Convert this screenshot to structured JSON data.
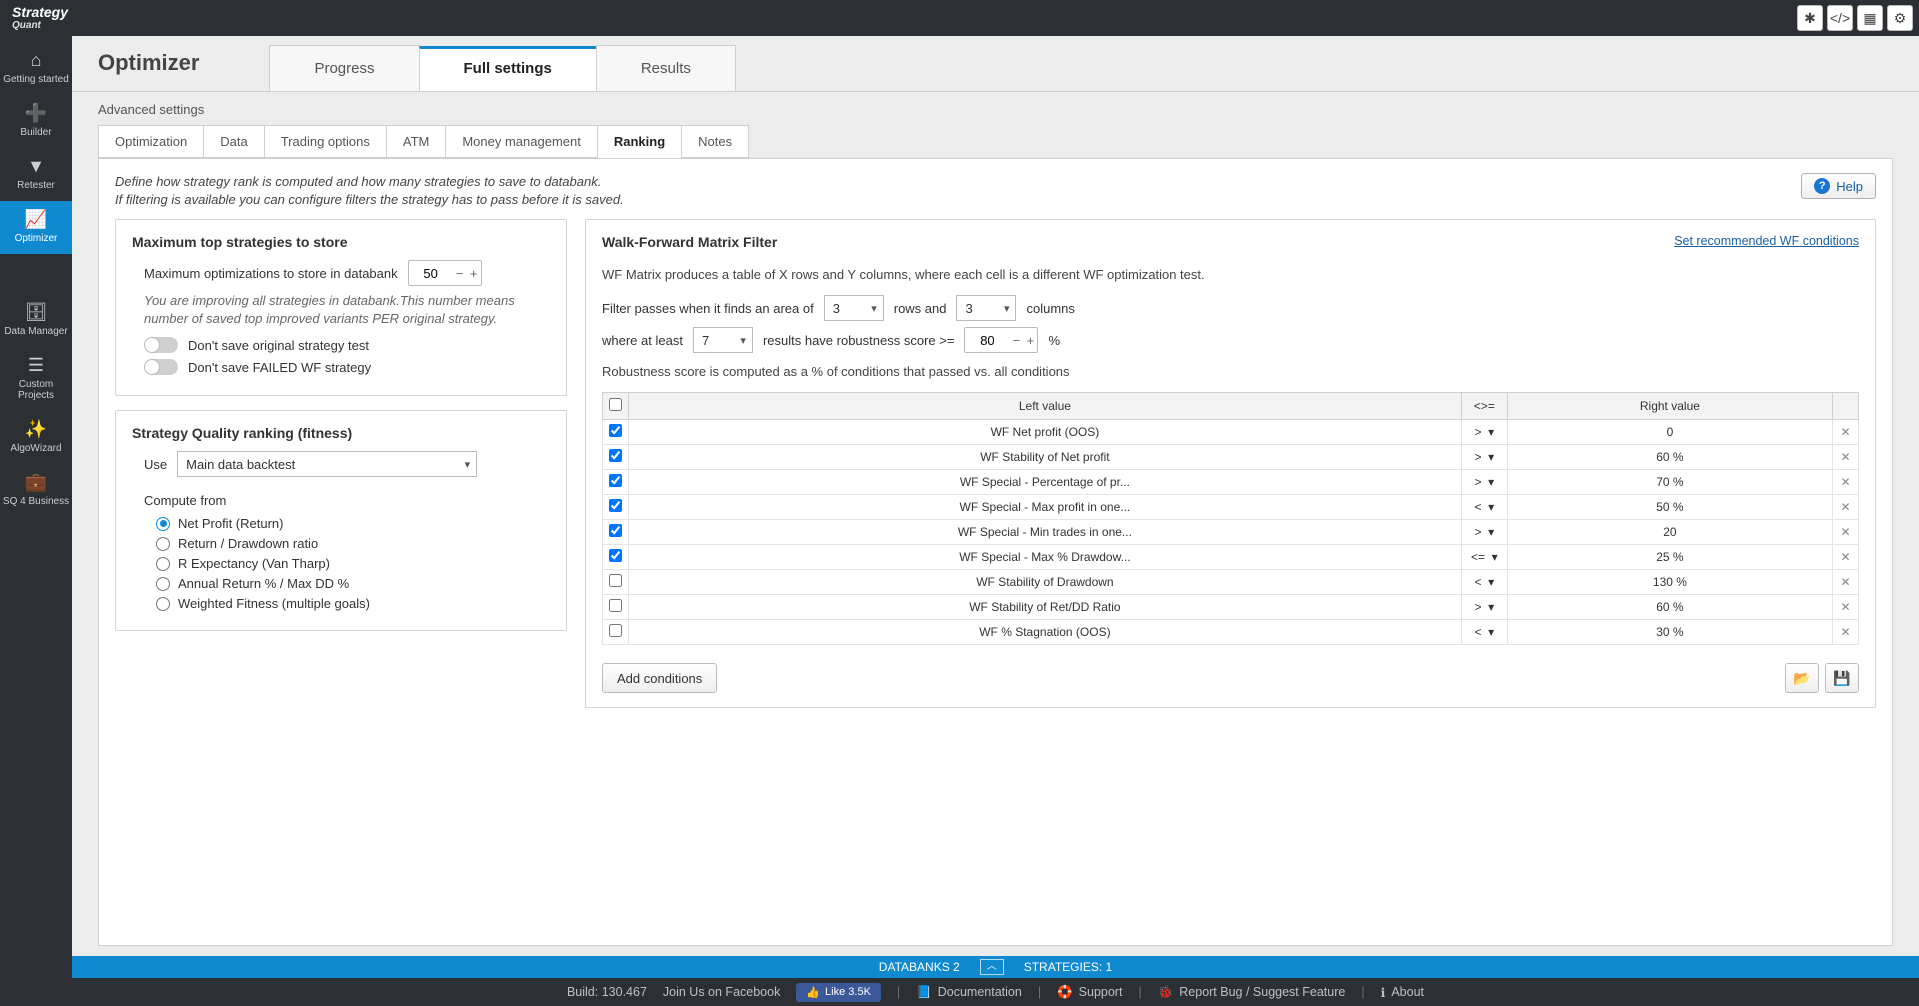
{
  "logo": {
    "line1": "Strategy",
    "line2": "Quant"
  },
  "sidebar": {
    "items": [
      {
        "label": "Getting started"
      },
      {
        "label": "Builder"
      },
      {
        "label": "Retester"
      },
      {
        "label": "Optimizer"
      },
      {
        "label": "Data Manager"
      },
      {
        "label": "Custom Projects"
      },
      {
        "label": "AlgoWizard"
      },
      {
        "label": "SQ 4 Business"
      }
    ]
  },
  "page": {
    "title": "Optimizer",
    "breadcrumb": "Advanced settings",
    "main_tabs": [
      "Progress",
      "Full settings",
      "Results"
    ],
    "sub_tabs": [
      "Optimization",
      "Data",
      "Trading options",
      "ATM",
      "Money management",
      "Ranking",
      "Notes"
    ]
  },
  "intro": {
    "line1": "Define how strategy rank is computed and how many strategies to save to databank.",
    "line2": "If filtering is available you can configure filters the strategy has to pass before it is saved."
  },
  "help_label": "Help",
  "max_store": {
    "title": "Maximum top strategies to store",
    "label": "Maximum optimizations to store in databank",
    "value": "50",
    "hint": "You are improving all strategies in databank.This number means number of saved top improved variants PER original strategy.",
    "toggle1": "Don't save original strategy test",
    "toggle2": "Don't save FAILED WF strategy"
  },
  "quality": {
    "title": "Strategy Quality ranking (fitness)",
    "use_label": "Use",
    "use_value": "Main data backtest",
    "compute_label": "Compute from",
    "options": [
      "Net Profit (Return)",
      "Return / Drawdown ratio",
      "R Expectancy (Van Tharp)",
      "Annual Return % / Max DD %",
      "Weighted Fitness (multiple goals)"
    ]
  },
  "wf": {
    "title": "Walk-Forward Matrix Filter",
    "link": "Set recommended WF conditions",
    "desc": "WF Matrix produces a table of X rows and Y columns, where each cell is a different WF optimization test.",
    "t1": "Filter passes when it finds an area of",
    "rows_val": "3",
    "t2": "rows and",
    "cols_val": "3",
    "t3": "columns",
    "t4": "where at least",
    "least_val": "7",
    "t5": "results have robustness score >=",
    "score_val": "80",
    "pct": "%",
    "note": "Robustness score is computed as a % of conditions that passed vs. all conditions",
    "headers": {
      "left": "Left value",
      "op": "<>=",
      "right": "Right value"
    },
    "rows": [
      {
        "checked": true,
        "left": "WF Net profit (OOS)",
        "op": ">",
        "right": "0"
      },
      {
        "checked": true,
        "left": "WF Stability of Net profit",
        "op": ">",
        "right": "60 %"
      },
      {
        "checked": true,
        "left": "WF Special - Percentage of pr...",
        "op": ">",
        "right": "70 %"
      },
      {
        "checked": true,
        "left": "WF Special - Max profit in one...",
        "op": "<",
        "right": "50 %"
      },
      {
        "checked": true,
        "left": "WF Special - Min trades in one...",
        "op": ">",
        "right": "20"
      },
      {
        "checked": true,
        "left": "WF Special - Max % Drawdow...",
        "op": "<=",
        "right": "25 %"
      },
      {
        "checked": false,
        "left": "WF Stability of Drawdown",
        "op": "<",
        "right": "130 %"
      },
      {
        "checked": false,
        "left": "WF Stability of Ret/DD Ratio",
        "op": ">",
        "right": "60 %"
      },
      {
        "checked": false,
        "left": "WF % Stagnation (OOS)",
        "op": "<",
        "right": "30 %"
      }
    ],
    "add_btn": "Add conditions"
  },
  "databanks": {
    "label": "DATABANKS 2",
    "strategies": "STRATEGIES: 1"
  },
  "status": {
    "build": "Build: 130.467",
    "fb": "Join Us on Facebook",
    "like": "Like 3.5K",
    "doc": "Documentation",
    "support": "Support",
    "bug": "Report Bug / Suggest Feature",
    "about": "About"
  }
}
